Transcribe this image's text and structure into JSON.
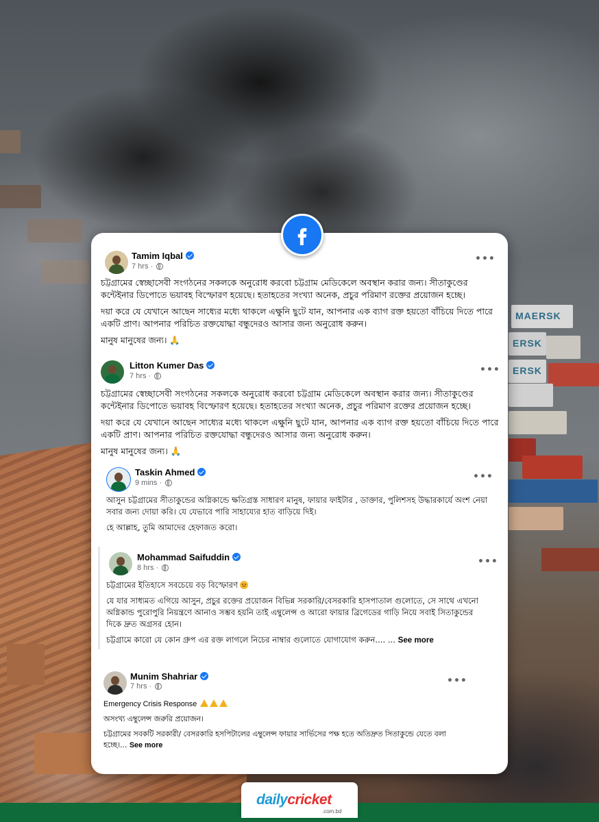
{
  "posts": [
    {
      "name": "Tamim Iqbal",
      "time": "7 hrs ·",
      "paragraphs": [
        "চট্টগ্রামের স্বেচ্ছাসেবী সংগঠনের সকলকে অনুরোধ করবো চট্টগ্রাম মেডিকেলে অবস্থান করার জন্য। সীতাকুণ্ডের কন্টেইনার ডিপোতে ভয়াবহ বিস্ফোরণ হয়েছে। হতাহতের সংখ্যা অনেক, প্রচুর পরিমাণ রক্তের প্রয়োজন হচ্ছে।",
        "দয়া করে যে যেখানে আছেন সাধ্যের মধ্যে থাকলে এক্ষুনি ছুটে যান, আপনার এক ব্যাগ রক্ত হয়তো বাঁচিয়ে দিতে পারে একটি প্রাণ। আপনার পরিচিত রক্তযোদ্ধা বন্ধুদেরও আসার জন্য অনুরোধ করুন।",
        "মানুষ মানুষের জন্য। 🙏"
      ]
    },
    {
      "name": "Litton Kumer Das",
      "time": "7 hrs ·",
      "paragraphs": [
        "চট্টগ্রামের স্বেচ্ছাসেবী সংগঠনের সকলকে অনুরোধ করবো চট্টগ্রাম মেডিকেলে অবস্থান করার জন্য। সীতাকুণ্ডের কন্টেইনার ডিপোতে ভয়াবহ বিস্ফোরণ হয়েছে। হতাহতের সংখ্যা অনেক, প্রচুর পরিমাণ রক্তের প্রয়োজন হচ্ছে।",
        "দয়া করে যে যেখানে আছেন সাধ্যের মধ্যে থাকলে এক্ষুনি ছুটে যান, আপনার এক ব্যাগ রক্ত হয়তো বাঁচিয়ে দিতে পারে একটি প্রাণ। আপনার পরিচিত রক্তযোদ্ধা বন্ধুদেরও আসার জন্য অনুরোধ করুন।",
        "মানুষ মানুষের জন্য। 🙏"
      ]
    },
    {
      "name": "Taskin Ahmed",
      "time": "9 mins ·",
      "paragraphs": [
        "আসুন চট্টগ্রামের সীতাকুন্ডের অগ্নিকান্ডে ক্ষতিগ্রস্ত সাধারণ মানুষ, ফায়ার ফাইটার , ডাক্তার, পুলিশসহ উদ্ধারকার্যে অংশ নেয়া সবার জন্য দোয়া করি।  যে যেভাবে পারি সাহায্যের হাত বাড়িয়ে দিই।",
        "হে আল্লাহ, তুমি আমাদের হেফাজত করো।"
      ]
    },
    {
      "name": "Mohammad Saifuddin",
      "time": "8 hrs ·",
      "paragraphs": [
        "চট্টগ্রামের ইতিহাসে সবচেয়ে বড় বিস্ফোরণ",
        "যে যার সাধ্যমত এগিয়ে আসুন, প্রচুর রক্তের প্রয়োজন বিভিন্ন সরকারি/বেসরকারি হাসপাতাল গুলোতে, সে সাথে এখনো অগ্নিকান্ড পুরোপুরি নিয়ন্ত্রণে আনাও সম্ভব হয়নি তাই এম্বুলেন্স ও আরো ফায়ার ব্রিগেডের গাড়ি নিয়ে সবাই সিতাকুন্ডের দিকে দ্রুত অগ্রসর হোন।",
        "চট্টগ্রামে কারো যে কোন গ্রুপ এর রক্ত লাগলে নিচের নাম্বার গুলোতে যোগাযোগ করুন....  ..."
      ],
      "see_more": "See more"
    },
    {
      "name": "Munim Shahriar",
      "time": "7 hrs ·",
      "paragraphs": [
        "Emergency Crisis Response",
        "অসংখ্য এম্বুলেন্স জরুরি প্রয়োজন।",
        "চট্টগ্রামের সবকটি সরকারী/ বেসরকারি হসপিটালের এম্বুলেন্স ফায়ার সার্ভিসের পক্ষ হতে অতিদ্রুত সিতাকুন্ডে যেতে বলা হচ্ছে।..."
      ],
      "see_more": "See more"
    }
  ],
  "brand": {
    "part1": "daily",
    "part2": "cricket",
    "domain": ".com.bd"
  },
  "colors": {
    "facebook_blue": "#1877f2",
    "brand_green": "#0f6b3a",
    "brand_blue": "#1d9bd7",
    "brand_red": "#e42f2f"
  },
  "icons": [
    "facebook-logo-icon",
    "verified-badge-icon",
    "globe-icon",
    "more-options-icon",
    "pray-emoji-icon",
    "warning-emoji-icon",
    "sad-emoji-icon"
  ]
}
